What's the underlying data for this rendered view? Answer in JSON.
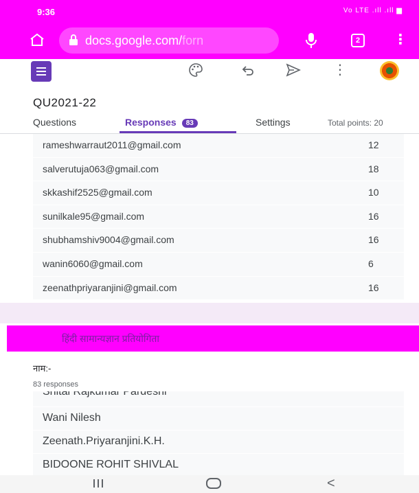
{
  "status_bar": {
    "time": "9:36",
    "indicators": "Vo LTE .ıll .ıll ▆"
  },
  "browser": {
    "url_main": "docs.google.com/",
    "url_faded": "forn",
    "tab_count": "2"
  },
  "toolbar": {
    "icons": [
      "palette-icon",
      "undo-icon",
      "send-icon",
      "more-vert-icon"
    ]
  },
  "form": {
    "title": "QU2021-22",
    "tabs": [
      {
        "label": "Questions"
      },
      {
        "label": "Responses",
        "badge": "83"
      },
      {
        "label": "Settings"
      }
    ],
    "total_points": "Total points: 20"
  },
  "email_rows": [
    {
      "email": "rameshwarraut2011@gmail.com",
      "score": "12"
    },
    {
      "email": "salverutuja063@gmail.com",
      "score": "18"
    },
    {
      "email": "skkashif2525@gmail.com",
      "score": "10"
    },
    {
      "email": "sunilkale95@gmail.com",
      "score": "16"
    },
    {
      "email": "shubhamshiv9004@gmail.com",
      "score": "16"
    },
    {
      "email": "wanin6060@gmail.com",
      "score": "6"
    },
    {
      "email": "zeenathpriyaranjini@gmail.com",
      "score": "16"
    }
  ],
  "section": {
    "title": "हिंदी सामान्यज्ञान प्रतियोगिता"
  },
  "question": {
    "title": "नाम:-",
    "responses": "83 responses",
    "answers": [
      "Shital Rajkumar Pardeshi",
      "Wani Nilesh",
      "Zeenath.Priyaranjini.K.H.",
      "BIDOONE ROHIT SHIVLAL"
    ]
  },
  "colors": {
    "accent": "#673ab7",
    "browser_bar": "#ff00ff"
  }
}
